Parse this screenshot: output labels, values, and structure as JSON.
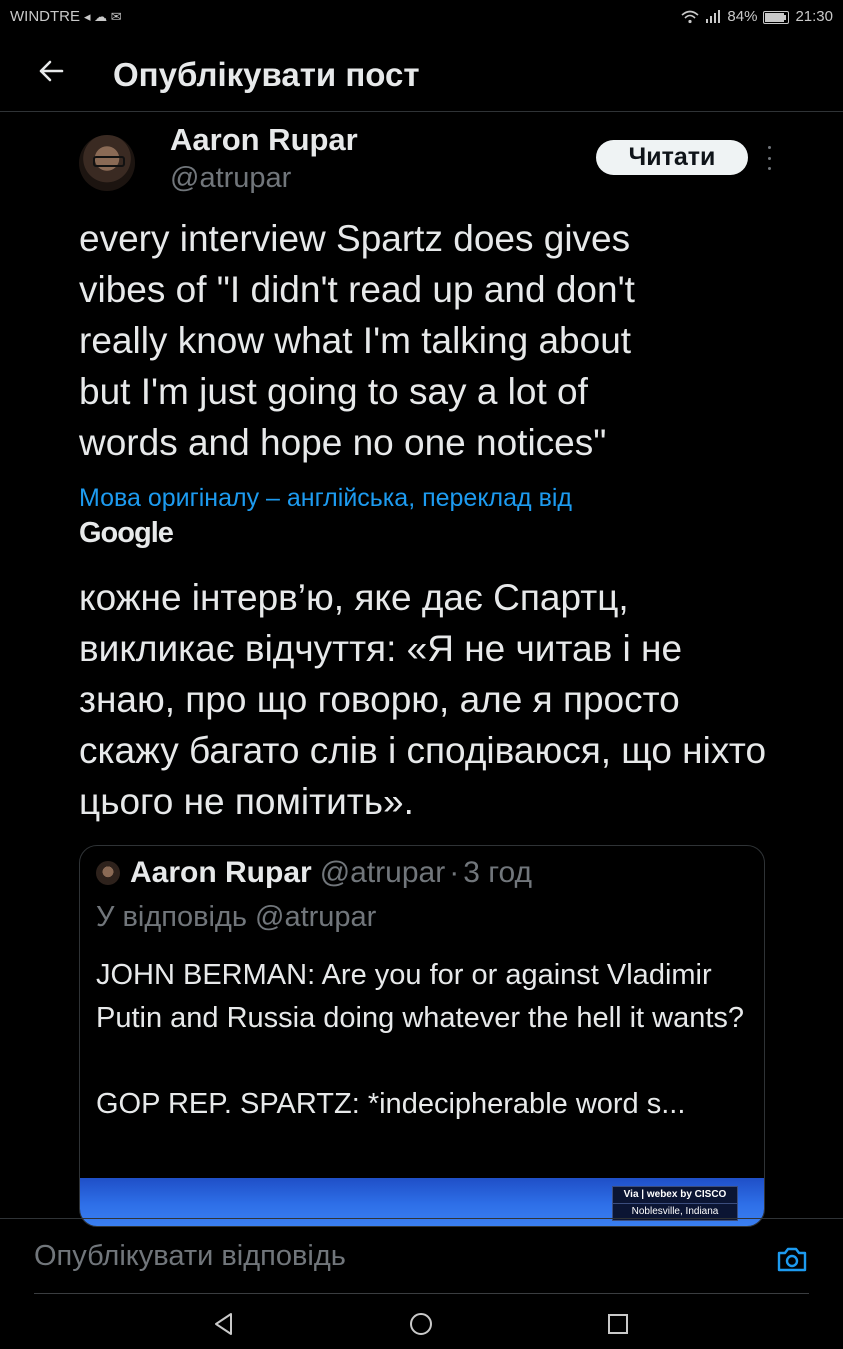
{
  "status_bar": {
    "carrier": "WINDTRE",
    "battery": "84%",
    "time": "21:30"
  },
  "header": {
    "title": "Опублікувати пост"
  },
  "author": {
    "name": "Aaron Rupar",
    "handle": "@atrupar",
    "follow_label": "Читати"
  },
  "tweet": {
    "text": "every interview Spartz does gives\nvibes of \"I didn't read up and don't\nreally know what I'm talking about\nbut I'm just going to say a lot of\nwords and hope no one notices\"",
    "translation_note": "Мова оригіналу – англійська, переклад від",
    "translation_provider": "Google",
    "translated_text": "кожне інтерв’ю, яке дає Спартц, викликає відчуття: «Я не читав і не знаю, про що говорю, але я просто скажу багато слів і сподіваюся, що ніхто цього не помітить»."
  },
  "quoted_tweet": {
    "name": "Aaron Rupar",
    "handle": "@atrupar",
    "separator": "·",
    "time": "3 год",
    "reply_to": "У відповідь @atrupar",
    "text_line_1": "JOHN BERMAN: Are you for or against Vladimir Putin and Russia doing whatever the hell it wants?",
    "text_line_2": "GOP REP. SPARTZ: *indecipherable word s...",
    "media_badge_line_1": "Via | webex by CISCO",
    "media_badge_line_2": "Noblesville, Indiana"
  },
  "reply_bar": {
    "placeholder": "Опублікувати відповідь"
  },
  "colors": {
    "background": "#000000",
    "text": "#e7e9ea",
    "secondary_text": "#71767b",
    "link": "#1d9bf0"
  },
  "icons": [
    "back-arrow-icon",
    "more-icon",
    "camera-icon",
    "nav-back-icon",
    "nav-home-icon",
    "nav-recents-icon",
    "wifi-icon",
    "signal-icon",
    "battery-icon"
  ]
}
